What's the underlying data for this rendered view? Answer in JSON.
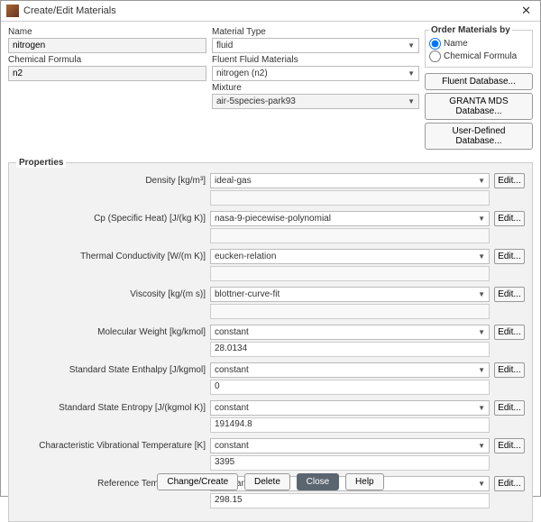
{
  "title": "Create/Edit Materials",
  "left": {
    "name_label": "Name",
    "name_value": "nitrogen",
    "formula_label": "Chemical Formula",
    "formula_value": "n2"
  },
  "mid": {
    "type_label": "Material Type",
    "type_value": "fluid",
    "fluid_label": "Fluent Fluid Materials",
    "fluid_value": "nitrogen (n2)",
    "mixture_label": "Mixture",
    "mixture_value": "air-5species-park93"
  },
  "order": {
    "legend": "Order Materials by",
    "opt_name": "Name",
    "opt_formula": "Chemical Formula"
  },
  "db": {
    "fluent": "Fluent Database...",
    "granta": "GRANTA MDS Database...",
    "user": "User-Defined Database..."
  },
  "props_legend": "Properties",
  "edit_label": "Edit...",
  "props": [
    {
      "label": "Density [kg/m³]",
      "method": "ideal-gas",
      "value": "",
      "white": false
    },
    {
      "label": "Cp (Specific Heat) [J/(kg K)]",
      "method": "nasa-9-piecewise-polynomial",
      "value": "",
      "white": false
    },
    {
      "label": "Thermal Conductivity [W/(m K)]",
      "method": "eucken-relation",
      "value": "",
      "white": false
    },
    {
      "label": "Viscosity [kg/(m s)]",
      "method": "blottner-curve-fit",
      "value": "",
      "white": false
    },
    {
      "label": "Molecular Weight [kg/kmol]",
      "method": "constant",
      "value": "28.0134",
      "white": true
    },
    {
      "label": "Standard State Enthalpy [J/kgmol]",
      "method": "constant",
      "value": "0",
      "white": true
    },
    {
      "label": "Standard State Entropy [J/(kgmol K)]",
      "method": "constant",
      "value": "191494.8",
      "white": true
    },
    {
      "label": "Characteristic Vibrational Temperature [K]",
      "method": "constant",
      "value": "3395",
      "white": true
    },
    {
      "label": "Reference Temperature [K]",
      "method": "constant",
      "value": "298.15",
      "white": true
    }
  ],
  "footer": {
    "change": "Change/Create",
    "delete": "Delete",
    "close": "Close",
    "help": "Help"
  }
}
